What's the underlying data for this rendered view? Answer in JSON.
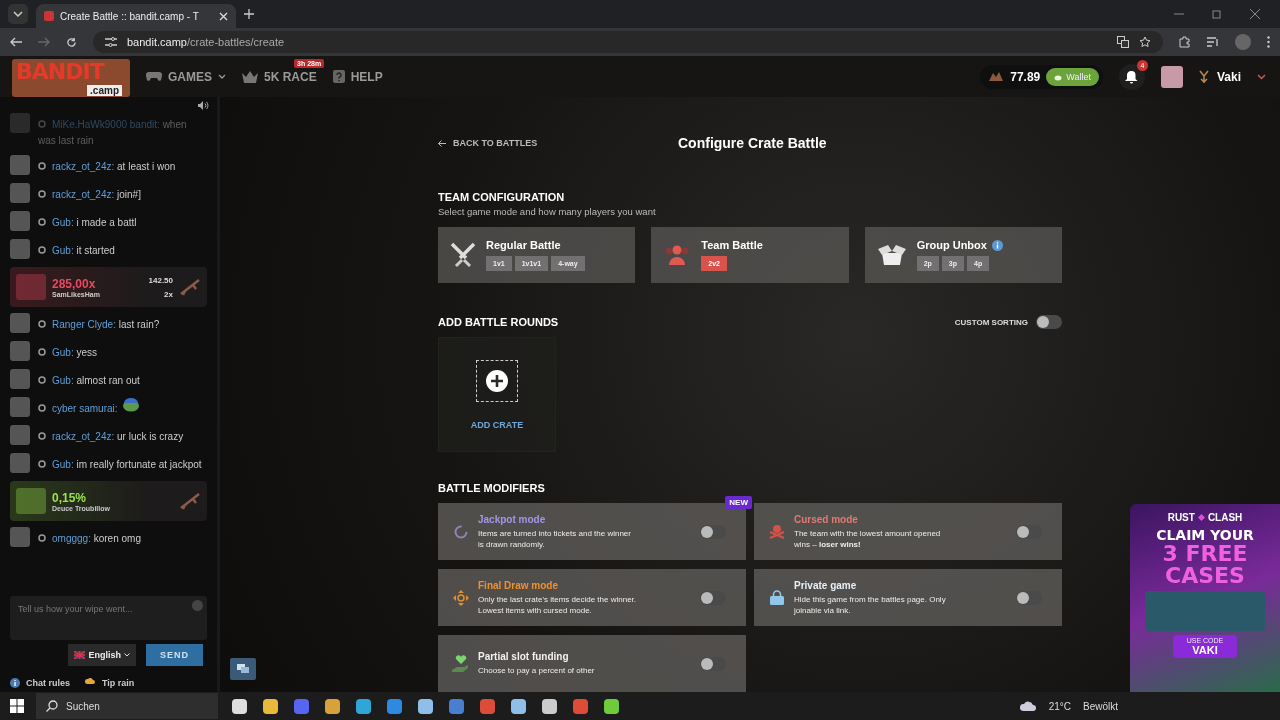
{
  "browser": {
    "tab_title": "Create Battle :: bandit.camp - T",
    "url_host": "bandit.camp",
    "url_path": "/crate-battles/create"
  },
  "header": {
    "logo": {
      "word": "BANDIT",
      "suffix": ".camp"
    },
    "nav": [
      {
        "label": "GAMES",
        "kind": "games",
        "dropdown": true
      },
      {
        "label": "5K RACE",
        "kind": "race",
        "badge": "3h 28m"
      },
      {
        "label": "HELP",
        "kind": "help"
      }
    ],
    "balance": "77.89",
    "wallet": "Wallet",
    "notifications": "4",
    "user": "Vaki"
  },
  "chat": {
    "messages": [
      {
        "kind": "message",
        "user": "MiKe.HaWk9000 bandit:",
        "text": "when was last rain",
        "faded": true
      },
      {
        "kind": "message",
        "user": "rackz_ot_24z:",
        "text": "at least i won",
        "faded": false
      },
      {
        "kind": "message",
        "user": "rackz_ot_24z:",
        "text": "join#]",
        "faded": false
      },
      {
        "kind": "message",
        "user": "Gub:",
        "text": "i made a battl",
        "faded": false
      },
      {
        "kind": "message",
        "user": "Gub:",
        "text": "it started",
        "faded": false
      },
      {
        "kind": "win",
        "multiplier": "285,00x",
        "user": "SamLikesHam",
        "amount": "142.50",
        "count": "2x",
        "color": "#e8495f"
      },
      {
        "kind": "message",
        "user": "Ranger Clyde:",
        "text": "last rain?",
        "faded": false
      },
      {
        "kind": "message",
        "user": "Gub:",
        "text": "yess",
        "faded": false
      },
      {
        "kind": "message",
        "user": "Gub:",
        "text": "almost ran out",
        "faded": false
      },
      {
        "kind": "message",
        "user": "cyber samurai:",
        "emoji": true,
        "faded": false
      },
      {
        "kind": "message",
        "user": "rackz_ot_24z:",
        "text": "ur luck is crazy",
        "faded": false
      },
      {
        "kind": "message",
        "user": "Gub:",
        "text": "im really fortunate at jackpot",
        "faded": false
      },
      {
        "kind": "win",
        "multiplier": "0,15%",
        "user": "Deuce Troubillow",
        "color": "#9be34b"
      },
      {
        "kind": "message",
        "user": "omgggg:",
        "text": "koren omg",
        "faded": false
      }
    ],
    "placeholder": "Tell us how your wipe went...",
    "language": "English",
    "send": "SEND",
    "links": [
      "Chat rules",
      "Tip rain"
    ]
  },
  "main": {
    "back": "BACK TO BATTLES",
    "title": "Configure Crate Battle",
    "team": {
      "title": "TEAM CONFIGURATION",
      "subtitle": "Select game mode and how many players you want",
      "modes": [
        {
          "kind": "regular",
          "name": "Regular Battle",
          "info": false,
          "options": [
            {
              "label": "1v1",
              "selected": false
            },
            {
              "label": "1v1v1",
              "selected": false
            },
            {
              "label": "4-way",
              "selected": false
            }
          ]
        },
        {
          "kind": "team",
          "name": "Team Battle",
          "info": false,
          "options": [
            {
              "label": "2v2",
              "selected": true
            }
          ]
        },
        {
          "kind": "group",
          "name": "Group Unbox",
          "info": true,
          "options": [
            {
              "label": "2p",
              "selected": false
            },
            {
              "label": "3p",
              "selected": false
            },
            {
              "label": "4p",
              "selected": false
            }
          ]
        }
      ]
    },
    "rounds": {
      "title": "ADD BATTLE ROUNDS",
      "sorting_label": "CUSTOM SORTING",
      "sorting_on": false,
      "add": "ADD CRATE"
    },
    "modifiers": {
      "title": "BATTLE MODIFIERS",
      "items": [
        {
          "kind": "jackpot",
          "title": "Jackpot mode",
          "description": "Items are turned into tickets and the winner is drawn randomly.",
          "badge": "NEW",
          "color": "#a594e8",
          "on": false
        },
        {
          "kind": "cursed",
          "title": "Cursed mode",
          "description": "The team with the lowest amount opened wins – **loser wins!**",
          "color": "#e07a72",
          "on": false
        },
        {
          "kind": "final",
          "title": "Final Draw mode",
          "description": "Only the last crate's items decide the winner. Lowest items with cursed mode.",
          "color": "#f0902c",
          "on": false
        },
        {
          "kind": "private",
          "title": "Private game",
          "description": "Hide this game from the battles page. Only joinable via link.",
          "color": "#e6f0f8",
          "on": false
        },
        {
          "kind": "partial",
          "title": "Partial slot funding",
          "description": "Choose to pay a percent of other",
          "color": "#f2f2f2",
          "on": false
        }
      ]
    }
  },
  "ad": {
    "brand": [
      "RUST",
      "CLASH"
    ],
    "headline": "CLAIM YOUR",
    "big": [
      "3 FREE",
      "CASES"
    ],
    "code_label": "USE CODE",
    "code": "VAKI"
  },
  "taskbar": {
    "search": "Suchen",
    "temperature": "21°C",
    "weather": "Bewölkt"
  }
}
